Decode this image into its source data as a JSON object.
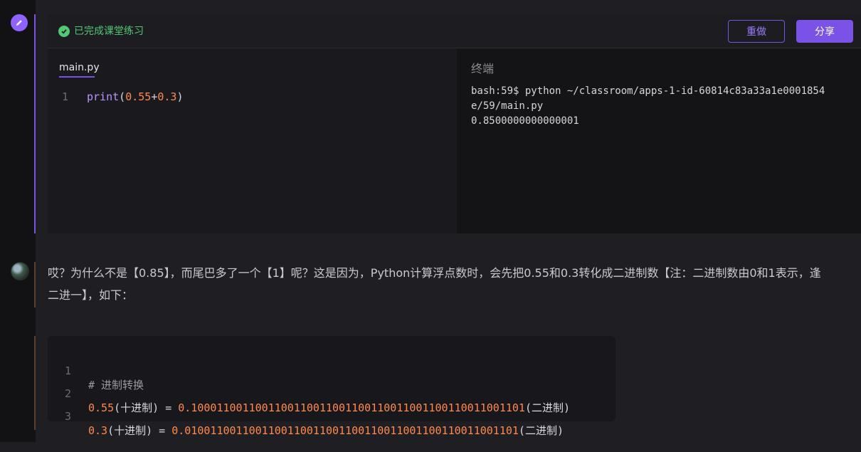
{
  "exercise": {
    "status_text": "已完成课堂练习",
    "redo_label": "重做",
    "share_label": "分享",
    "file_tab": "main.py",
    "code_lines": [
      {
        "number": "1",
        "func": "print",
        "open": "(",
        "a": "0.55",
        "op": "+",
        "b": "0.3",
        "close": ")"
      }
    ],
    "terminal_title": "终端",
    "terminal_output": "bash:59$ python ~/classroom/apps-1-id-60814c83a33a1e0001854\ne/59/main.py\n0.8500000000000001"
  },
  "explanation": {
    "paragraph": "哎？为什么不是【0.85】，而尾巴多了一个【1】呢？这是因为，Python计算浮点数时，会先把0.55和0.3转化成二进制数【注：二进制数由0和1表示，逢二进一】，如下："
  },
  "conversion_block": {
    "lines": [
      {
        "number": "1",
        "comment": "# 进制转换"
      },
      {
        "number": "2",
        "value": "0.55",
        "base_label": "(十进制)",
        "eq": " = ",
        "binary": "0.1000110011001100110011001100110011001100110011001101",
        "result_label": "(二进制)"
      },
      {
        "number": "3",
        "value": "0.3",
        "base_label": "(十进制)",
        "eq": " = ",
        "binary": "0.0100110011001100110011001100110011001100110011001101",
        "result_label": "(二进制)"
      }
    ]
  },
  "colors": {
    "accent": "#7a52e6",
    "success": "#52c776",
    "number": "#ff8a4c"
  }
}
